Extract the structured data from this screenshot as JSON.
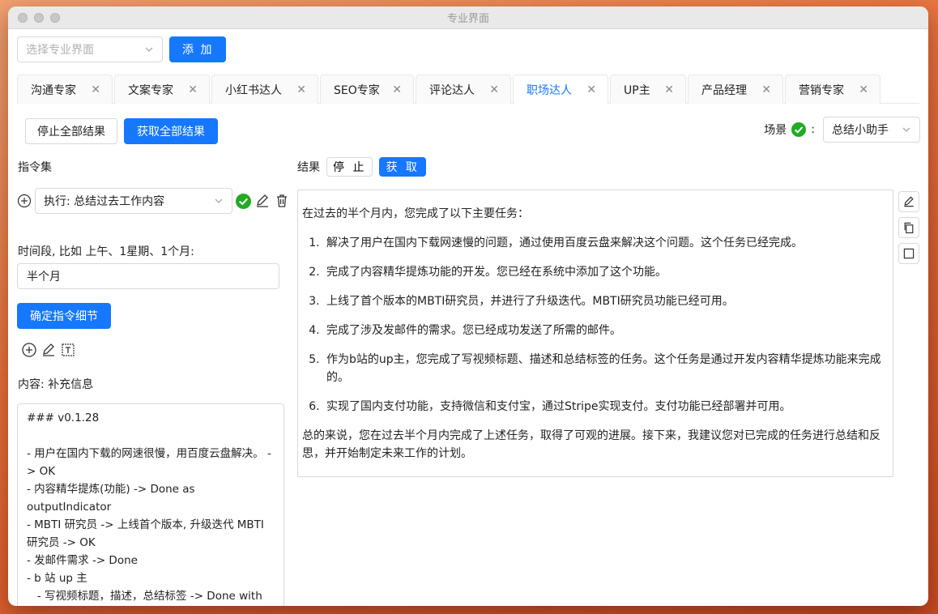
{
  "window": {
    "title": "专业界面"
  },
  "top": {
    "select_placeholder": "选择专业界面",
    "add_label": "添 加"
  },
  "tabs": [
    {
      "label": "沟通专家"
    },
    {
      "label": "文案专家"
    },
    {
      "label": "小红书达人"
    },
    {
      "label": "SEO专家"
    },
    {
      "label": "评论达人"
    },
    {
      "label": "职场达人",
      "active": true
    },
    {
      "label": "UP主"
    },
    {
      "label": "产品经理"
    },
    {
      "label": "营销专家"
    }
  ],
  "actions": {
    "stop_all": "停止全部结果",
    "get_all": "获取全部结果"
  },
  "scene": {
    "label": "场景",
    "colon": ":",
    "value": "总结小助手"
  },
  "left": {
    "instructions_label": "指令集",
    "command_select": "执行: 总结过去工作内容",
    "time_label": "时间段, 比如 上午、1星期、1个月:",
    "time_value": "半个月",
    "confirm_label": "确定指令细节",
    "content_label": "内容: 补充信息",
    "content_text": "### v0.1.28\n\n- 用户在国内下载的网速很慢，用百度云盘解决。 -> OK\n- 内容精华提炼(功能) -> Done as outputIndicator\n- MBTI 研究员 -> 上线首个版本, 升级迭代 MBTI 研究员 -> OK\n- 发邮件需求 -> Done\n- b 站 up 主\n   - 写视频标题，描述，总结标签 -> Done with 内容精华提炼功能开发"
  },
  "right": {
    "result_label": "结果",
    "stop_label": "停 止",
    "get_label": "获 取",
    "intro": "在过去的半个月内，您完成了以下主要任务：",
    "items": [
      "解决了用户在国内下载网速慢的问题，通过使用百度云盘来解决这个问题。这个任务已经完成。",
      "完成了内容精华提炼功能的开发。您已经在系统中添加了这个功能。",
      "上线了首个版本的MBTI研究员，并进行了升级迭代。MBTI研究员功能已经可用。",
      "完成了涉及发邮件的需求。您已经成功发送了所需的邮件。",
      "作为b站的up主，您完成了写视频标题、描述和总结标签的任务。这个任务是通过开发内容精华提炼功能来完成的。",
      "实现了国内支付功能，支持微信和支付宝，通过Stripe实现支付。支付功能已经部署并可用。"
    ],
    "summary": "总的来说，您在过去半个月内完成了上述任务，取得了可观的进展。接下来，我建议您对已完成的任务进行总结和反思，并开始制定未来工作的计划。"
  },
  "colors": {
    "primary": "#1677ff",
    "success": "#22aa22"
  }
}
